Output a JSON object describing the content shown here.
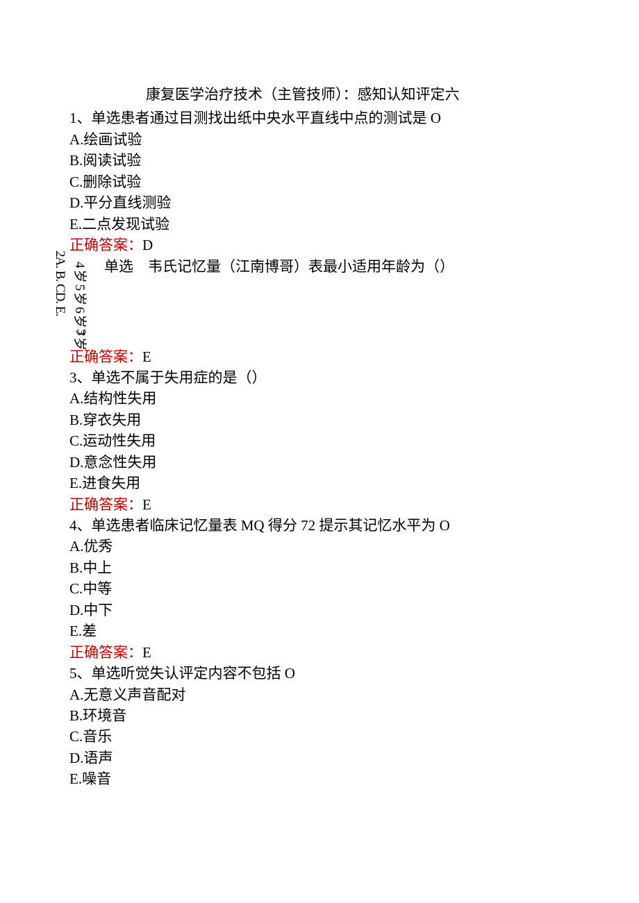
{
  "title": "康复医学治疗技术（主管技师）：感知认知评定六",
  "q1": {
    "stem": "1、单选患者通过目测找出纸中央水平直线中点的测试是 O",
    "A": "A.绘画试验",
    "B": "B.阅读试验",
    "C": "C.删除试验",
    "D": "D.平分直线测验",
    "E": "E.二点发现试验",
    "answer_label": "正确答案：",
    "answer_value": "D"
  },
  "q2": {
    "stem_prefix": "单选",
    "stem_rest": "韦氏记忆量（江南博哥）表最小适用年龄为（）",
    "rotated_labels": "2A. B. CD. E.",
    "rotated_options": "4岁5岁6岁7岁",
    "extra": "3",
    "answer_label": "正确答案：",
    "answer_value": "E"
  },
  "q3": {
    "stem": "3、单选不属于失用症的是（）",
    "A": "A.结构性失用",
    "B": "B.穿衣失用",
    "C": "C.运动性失用",
    "D": "D.意念性失用",
    "E": "E.进食失用",
    "answer_label": "正确答案：",
    "answer_value": "E"
  },
  "q4": {
    "stem": "4、单选患者临床记忆量表 MQ 得分 72 提示其记忆水平为 O",
    "A": "A.优秀",
    "B": "B.中上",
    "C": "C.中等",
    "D": "D.中下",
    "E": "E.差",
    "answer_label": "正确答案：",
    "answer_value": "E"
  },
  "q5": {
    "stem": "5、单选听觉失认评定内容不包括 O",
    "A": "A.无意义声音配对",
    "B": "B.环境音",
    "C": "C.音乐",
    "D": "D.语声",
    "E": "E.噪音"
  }
}
